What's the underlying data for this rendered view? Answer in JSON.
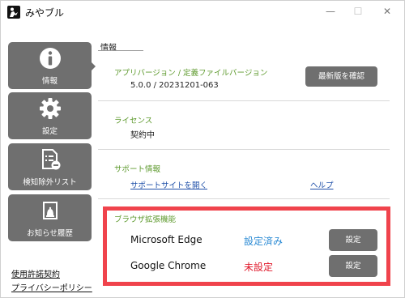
{
  "app": {
    "title": "みやブル",
    "icon": "app-logo-icon"
  },
  "window_controls": {
    "minimize_icon": "minimize-icon",
    "maximize_icon": "maximize-icon",
    "close_icon": "close-icon",
    "minimize_glyph": "—",
    "maximize_glyph": "☐",
    "close_glyph": "✕"
  },
  "sidebar": {
    "items": [
      {
        "label": "情報",
        "icon": "info-icon",
        "selected": true
      },
      {
        "label": "設定",
        "icon": "gear-icon",
        "selected": false
      },
      {
        "label": "検知除外リスト",
        "icon": "exclusion-list-icon",
        "selected": false
      },
      {
        "label": "お知らせ履歴",
        "icon": "bell-icon",
        "selected": false
      }
    ],
    "links": [
      "使用許諾契約",
      "プライバシーポリシー"
    ]
  },
  "panel": {
    "title": "情報",
    "version": {
      "heading": "アプリバージョン / 定義ファイルバージョン",
      "value": "5.0.0 / 20231201-063",
      "button": "最新版を確認"
    },
    "license": {
      "heading": "ライセンス",
      "value": "契約中"
    },
    "support": {
      "heading": "サポート情報",
      "site_link": "サポートサイトを開く",
      "help_link": "ヘルプ"
    },
    "extensions": {
      "heading": "ブラウザ拡張機能",
      "rows": [
        {
          "browser": "Microsoft Edge",
          "status": "設定済み",
          "button": "設定"
        },
        {
          "browser": "Google Chrome",
          "status": "未設定",
          "button": "設定"
        }
      ]
    }
  },
  "colors": {
    "accent_green": "#5e9a2e",
    "button_gray": "#6f6f6f",
    "link_blue": "#1e4fa8",
    "status_ok": "#2a8ad4",
    "status_ng": "#e0192b",
    "highlight_red": "#f0434c"
  }
}
